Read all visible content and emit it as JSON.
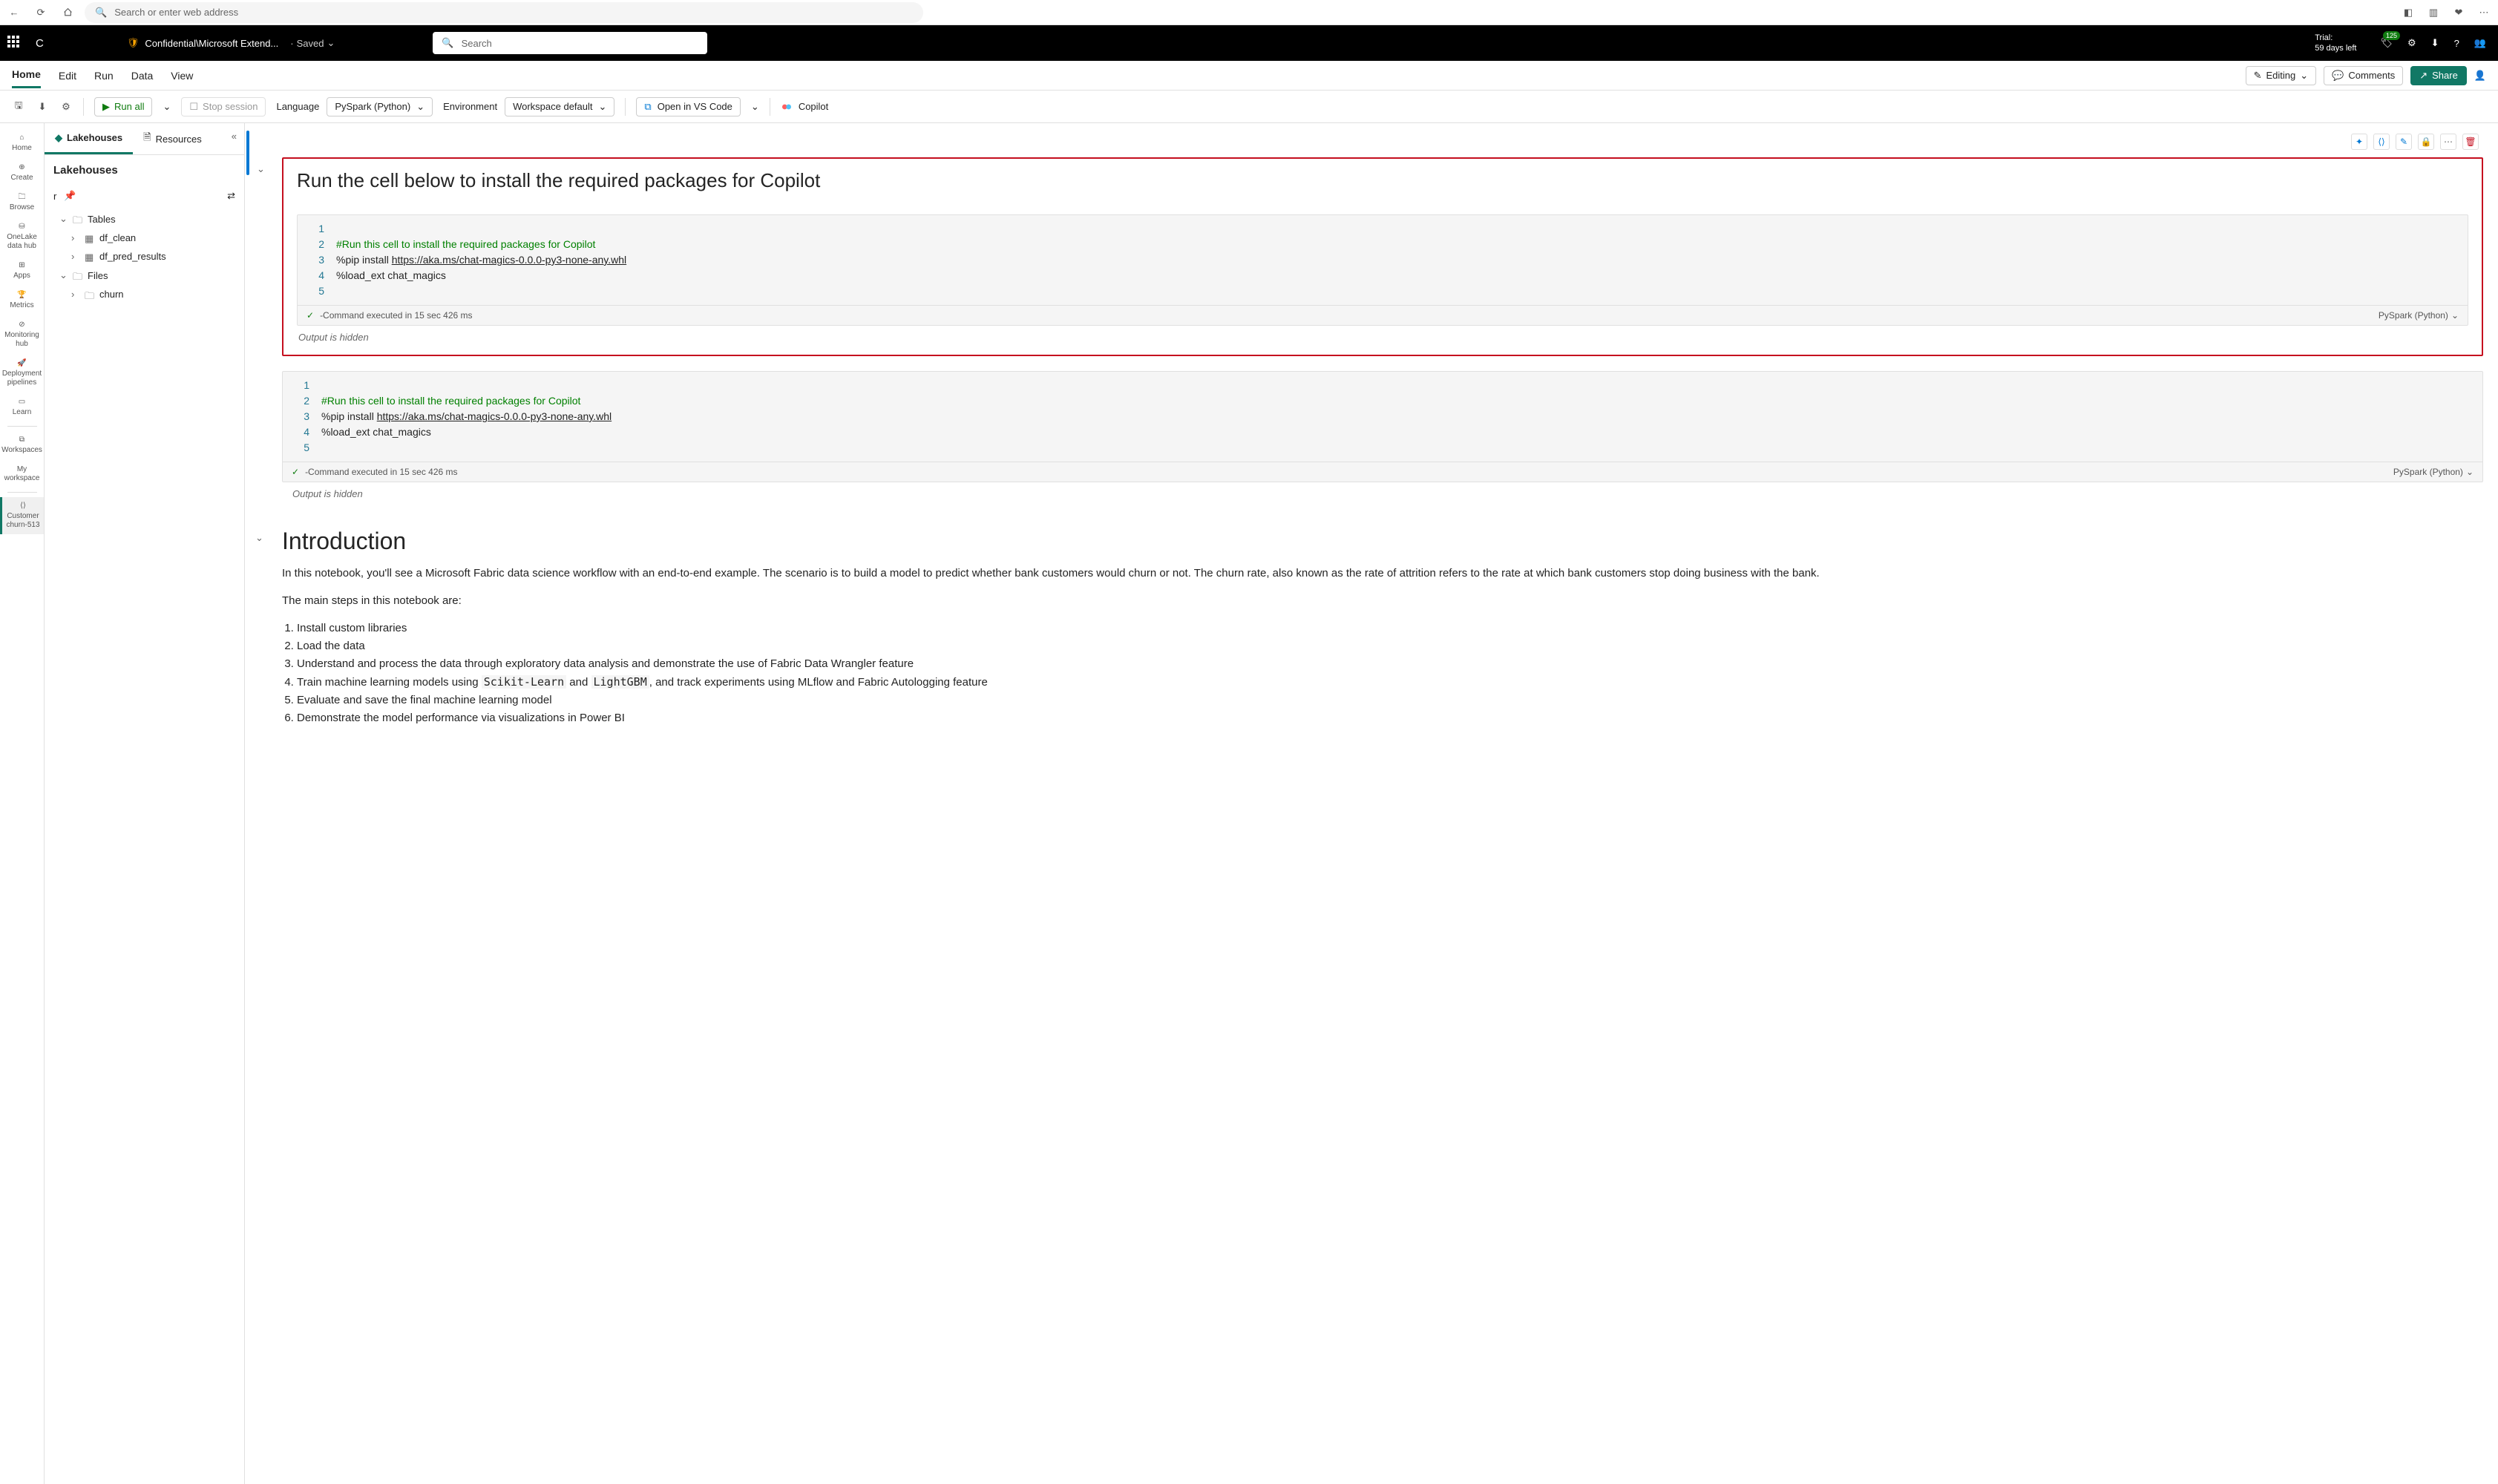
{
  "browser": {
    "placeholder": "Search or enter web address"
  },
  "fabric_bar": {
    "logo_letter": "C",
    "breadcrumb": "Confidential\\Microsoft Extend...",
    "saved": "Saved",
    "search_placeholder": "Search",
    "trial_line1": "Trial:",
    "trial_line2": "59 days left",
    "badge": "125"
  },
  "ribbon": {
    "tabs": [
      "Home",
      "Edit",
      "Run",
      "Data",
      "View"
    ],
    "editing": "Editing",
    "comments": "Comments",
    "share": "Share"
  },
  "toolbar": {
    "run_all": "Run all",
    "stop": "Stop session",
    "language_label": "Language",
    "language_value": "PySpark (Python)",
    "env_label": "Environment",
    "env_value": "Workspace default",
    "vscode": "Open in VS Code",
    "copilot": "Copilot"
  },
  "left_rail": [
    {
      "label": "Home"
    },
    {
      "label": "Create"
    },
    {
      "label": "Browse"
    },
    {
      "label": "OneLake data hub"
    },
    {
      "label": "Apps"
    },
    {
      "label": "Metrics"
    },
    {
      "label": "Monitoring hub"
    },
    {
      "label": "Deployment pipelines"
    },
    {
      "label": "Learn"
    },
    {
      "label": "Workspaces"
    },
    {
      "label": "My workspace"
    },
    {
      "label": "Customer churn-513"
    }
  ],
  "explorer": {
    "tab1": "Lakehouses",
    "tab2": "Resources",
    "title": "Lakehouses",
    "row_char": "r",
    "tree": {
      "tables": "Tables",
      "df_clean": "df_clean",
      "df_pred": "df_pred_results",
      "files": "Files",
      "churn": "churn"
    }
  },
  "cell1": {
    "heading": "Run the cell below to install the required packages for Copilot",
    "lines": {
      "l2": "#Run this cell to install the required packages for Copilot",
      "l3_pre": "%pip install ",
      "l3_link": "https://aka.ms/chat-magics-0.0.0-py3-none-any.whl",
      "l4": "%load_ext chat_magics"
    },
    "status": "-Command executed in 15 sec 426 ms",
    "lang": "PySpark (Python)",
    "output": "Output is hidden"
  },
  "intro": {
    "heading": "Introduction",
    "p1": "In this notebook, you'll see a Microsoft Fabric data science workflow with an end-to-end example. The scenario is to build a model to predict whether bank customers would churn or not. The churn rate, also known as the rate of attrition refers to the rate at which bank customers stop doing business with the bank.",
    "p2": "The main steps in this notebook are:",
    "steps": [
      "Install custom libraries",
      "Load the data",
      "Understand and process the data through exploratory data analysis and demonstrate the use of Fabric Data Wrangler feature",
      "Train machine learning models using ",
      "Evaluate and save the final machine learning model",
      "Demonstrate the model performance via visualizations in Power BI"
    ],
    "step4_mono1": "Scikit-Learn",
    "step4_and": " and ",
    "step4_mono2": "LightGBM",
    "step4_tail": ", and track experiments using MLflow and Fabric Autologging feature"
  }
}
